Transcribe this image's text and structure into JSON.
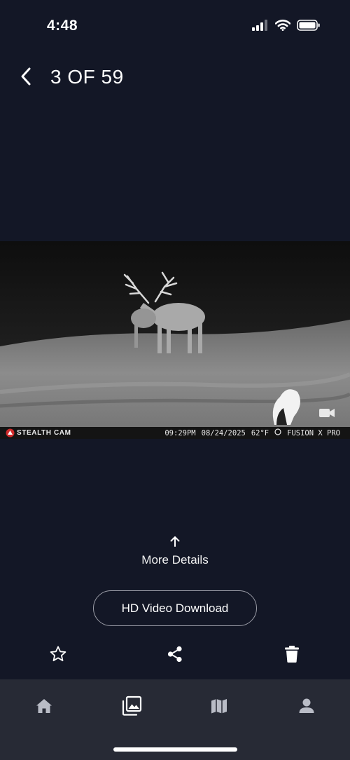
{
  "status_bar": {
    "time": "4:48",
    "icons": [
      "cellular-signal-icon",
      "wifi-icon",
      "battery-icon"
    ]
  },
  "header": {
    "back_icon": "chevron-left-icon",
    "title": "3 OF 59"
  },
  "media": {
    "brand": "STEALTH CAM",
    "stamp_time": "09:29PM",
    "stamp_date": "08/24/2025",
    "stamp_temp": "62°F",
    "stamp_device": "FUSION X PRO",
    "overlay_icon": "video-camera-icon"
  },
  "more_details": {
    "label": "More Details",
    "icon": "arrow-up-icon"
  },
  "hd_download": {
    "label": "HD Video Download"
  },
  "actions": [
    "star-icon",
    "share-icon",
    "trash-icon"
  ],
  "bottom_nav": {
    "items": [
      "home-icon",
      "gallery-icon",
      "map-icon",
      "profile-icon"
    ],
    "active_color": "#ffffff",
    "inactive_color": "#b9bcc6"
  },
  "colors": {
    "background": "#131726",
    "nav_background": "#272a35"
  }
}
